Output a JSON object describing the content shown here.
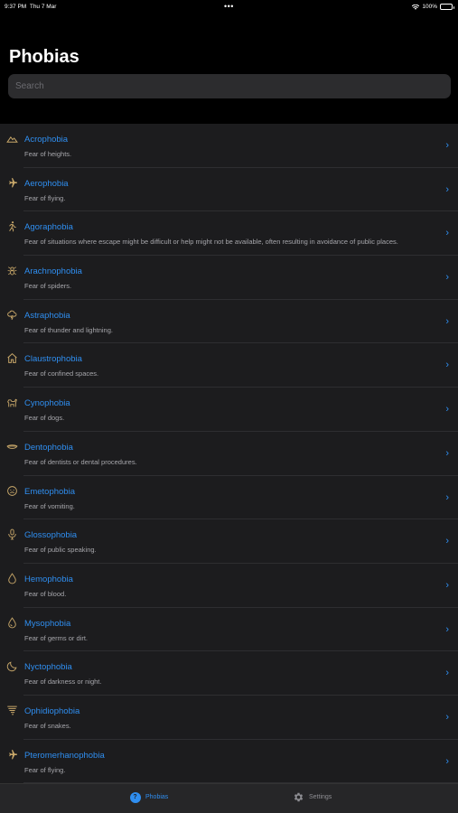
{
  "status_bar": {
    "time": "9:37 PM",
    "date": "Thu 7 Mar",
    "dots": "•••",
    "battery": "100%"
  },
  "header": {
    "title": "Phobias"
  },
  "search": {
    "placeholder": "Search"
  },
  "colors": {
    "accent": "#2f8ef0",
    "icon_tint": "#c9a86a",
    "background": "#000000",
    "list_bg": "#1c1c1e"
  },
  "phobias": [
    {
      "name": "Acrophobia",
      "description": "Fear of heights.",
      "icon": "mountain-icon"
    },
    {
      "name": "Aerophobia",
      "description": "Fear of flying.",
      "icon": "airplane-icon"
    },
    {
      "name": "Agoraphobia",
      "description": "Fear of situations where escape might be difficult or help might not be available, often resulting in avoidance of public places.",
      "icon": "running-person-icon"
    },
    {
      "name": "Arachnophobia",
      "description": "Fear of spiders.",
      "icon": "spider-icon"
    },
    {
      "name": "Astraphobia",
      "description": "Fear of thunder and lightning.",
      "icon": "cloud-lightning-icon"
    },
    {
      "name": "Claustrophobia",
      "description": "Fear of confined spaces.",
      "icon": "house-icon"
    },
    {
      "name": "Cynophobia",
      "description": "Fear of dogs.",
      "icon": "dog-icon"
    },
    {
      "name": "Dentophobia",
      "description": "Fear of dentists or dental procedures.",
      "icon": "mouth-icon"
    },
    {
      "name": "Emetophobia",
      "description": "Fear of vomiting.",
      "icon": "sick-face-icon"
    },
    {
      "name": "Glossophobia",
      "description": "Fear of public speaking.",
      "icon": "microphone-icon"
    },
    {
      "name": "Hemophobia",
      "description": "Fear of blood.",
      "icon": "drop-icon"
    },
    {
      "name": "Mysophobia",
      "description": "Fear of germs or dirt.",
      "icon": "drop-outline-icon"
    },
    {
      "name": "Nyctophobia",
      "description": "Fear of darkness or night.",
      "icon": "moon-icon"
    },
    {
      "name": "Ophidiophobia",
      "description": "Fear of snakes.",
      "icon": "tornado-icon"
    },
    {
      "name": "Pteromerhanophobia",
      "description": "Fear of flying.",
      "icon": "airplane-icon"
    }
  ],
  "tab_bar": {
    "tabs": [
      {
        "label": "Phobias",
        "selected": true
      },
      {
        "label": "Settings",
        "selected": false
      }
    ]
  }
}
